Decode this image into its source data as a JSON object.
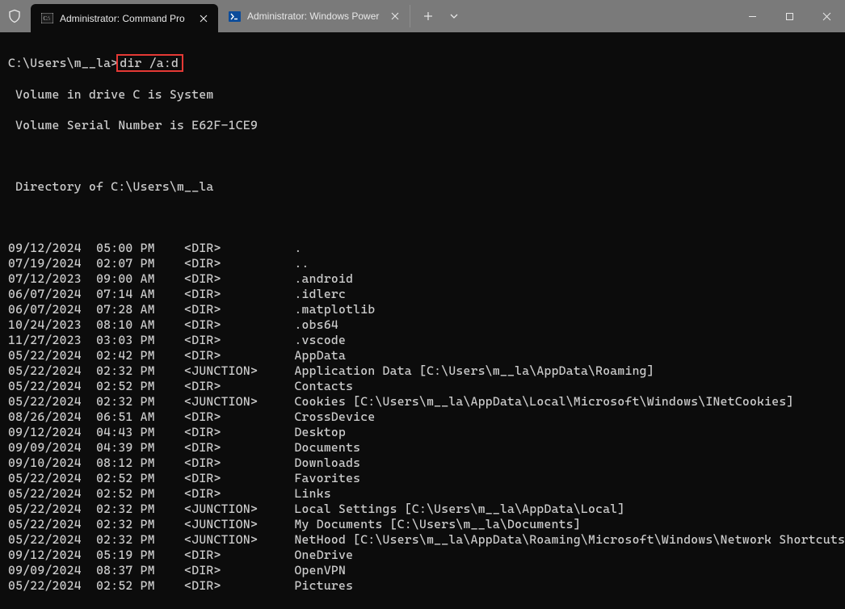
{
  "titlebar": {
    "tab1": {
      "title": "Administrator: Command Pro"
    },
    "tab2": {
      "title": "Administrator: Windows Power"
    }
  },
  "terminal": {
    "prompt_path": "C:\\Users\\m__la",
    "prompt_sep": ">",
    "command": "dir /a:d",
    "vol_line": " Volume in drive C is System",
    "serial_line": " Volume Serial Number is E62F-1CE9",
    "directory_of": " Directory of C:\\Users\\m__la",
    "entries": [
      {
        "date": "09/12/2024",
        "time": "05:00 PM",
        "type": "<DIR>",
        "name": "."
      },
      {
        "date": "07/19/2024",
        "time": "02:07 PM",
        "type": "<DIR>",
        "name": ".."
      },
      {
        "date": "07/12/2023",
        "time": "09:00 AM",
        "type": "<DIR>",
        "name": ".android"
      },
      {
        "date": "06/07/2024",
        "time": "07:14 AM",
        "type": "<DIR>",
        "name": ".idlerc"
      },
      {
        "date": "06/07/2024",
        "time": "07:28 AM",
        "type": "<DIR>",
        "name": ".matplotlib"
      },
      {
        "date": "10/24/2023",
        "time": "08:10 AM",
        "type": "<DIR>",
        "name": ".obs64"
      },
      {
        "date": "11/27/2023",
        "time": "03:03 PM",
        "type": "<DIR>",
        "name": ".vscode"
      },
      {
        "date": "05/22/2024",
        "time": "02:42 PM",
        "type": "<DIR>",
        "name": "AppData"
      },
      {
        "date": "05/22/2024",
        "time": "02:32 PM",
        "type": "<JUNCTION>",
        "name": "Application Data [C:\\Users\\m__la\\AppData\\Roaming]"
      },
      {
        "date": "05/22/2024",
        "time": "02:52 PM",
        "type": "<DIR>",
        "name": "Contacts"
      },
      {
        "date": "05/22/2024",
        "time": "02:32 PM",
        "type": "<JUNCTION>",
        "name": "Cookies [C:\\Users\\m__la\\AppData\\Local\\Microsoft\\Windows\\INetCookies]"
      },
      {
        "date": "08/26/2024",
        "time": "06:51 AM",
        "type": "<DIR>",
        "name": "CrossDevice"
      },
      {
        "date": "09/12/2024",
        "time": "04:43 PM",
        "type": "<DIR>",
        "name": "Desktop"
      },
      {
        "date": "09/09/2024",
        "time": "04:39 PM",
        "type": "<DIR>",
        "name": "Documents"
      },
      {
        "date": "09/10/2024",
        "time": "08:12 PM",
        "type": "<DIR>",
        "name": "Downloads"
      },
      {
        "date": "05/22/2024",
        "time": "02:52 PM",
        "type": "<DIR>",
        "name": "Favorites"
      },
      {
        "date": "05/22/2024",
        "time": "02:52 PM",
        "type": "<DIR>",
        "name": "Links"
      },
      {
        "date": "05/22/2024",
        "time": "02:32 PM",
        "type": "<JUNCTION>",
        "name": "Local Settings [C:\\Users\\m__la\\AppData\\Local]"
      },
      {
        "date": "05/22/2024",
        "time": "02:32 PM",
        "type": "<JUNCTION>",
        "name": "My Documents [C:\\Users\\m__la\\Documents]"
      },
      {
        "date": "05/22/2024",
        "time": "02:32 PM",
        "type": "<JUNCTION>",
        "name": "NetHood [C:\\Users\\m__la\\AppData\\Roaming\\Microsoft\\Windows\\Network Shortcuts]"
      },
      {
        "date": "09/12/2024",
        "time": "05:19 PM",
        "type": "<DIR>",
        "name": "OneDrive"
      },
      {
        "date": "09/09/2024",
        "time": "08:37 PM",
        "type": "<DIR>",
        "name": "OpenVPN"
      },
      {
        "date": "05/22/2024",
        "time": "02:52 PM",
        "type": "<DIR>",
        "name": "Pictures"
      }
    ]
  }
}
